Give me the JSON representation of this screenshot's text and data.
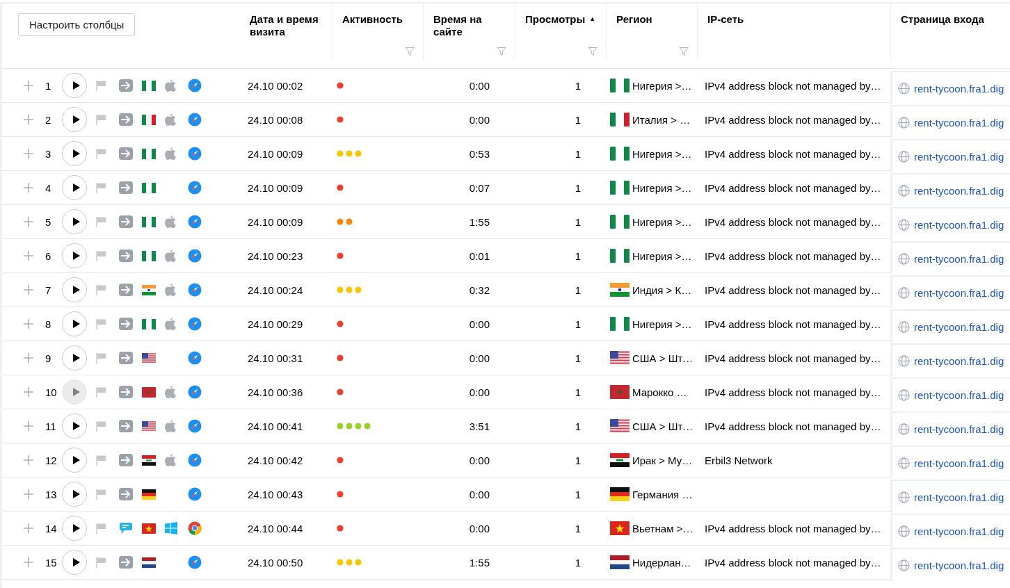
{
  "toolbar": {
    "configure_button": "Настроить столбцы"
  },
  "columns": [
    {
      "label": "Дата и время визита",
      "filter": false
    },
    {
      "label": "Активность",
      "filter": true
    },
    {
      "label": "Время на сайте",
      "filter": true
    },
    {
      "label": "Просмотры",
      "filter": true,
      "sort_mark": "▲"
    },
    {
      "label": "Регион",
      "filter": true
    },
    {
      "label": "IP-сеть",
      "filter": false
    },
    {
      "label": "Страница входа",
      "filter": false
    }
  ],
  "rows": [
    {
      "number": "1",
      "viewed": false,
      "source": {
        "kind": "direct"
      },
      "country": {
        "kind": "ng"
      },
      "os": {
        "kind": "apple"
      },
      "browser": {
        "kind": "safari"
      },
      "datetime": "24.10 00:02",
      "activity": {
        "kind": "low"
      },
      "duration": "0:00",
      "views": "1",
      "region": "Нигерия >…",
      "ip": "IPv4 address block not managed by…",
      "page": "rent-tycoon.fra1.dig"
    },
    {
      "number": "2",
      "viewed": false,
      "source": {
        "kind": "direct"
      },
      "country": {
        "kind": "it"
      },
      "os": {
        "kind": "apple"
      },
      "browser": {
        "kind": "safari"
      },
      "datetime": "24.10 00:08",
      "activity": {
        "kind": "low"
      },
      "duration": "0:00",
      "views": "1",
      "region": "Италия > …",
      "ip": "IPv4 address block not managed by…",
      "page": "rent-tycoon.fra1.dig"
    },
    {
      "number": "3",
      "viewed": false,
      "source": {
        "kind": "direct"
      },
      "country": {
        "kind": "ng"
      },
      "os": {
        "kind": "apple"
      },
      "browser": {
        "kind": "safari"
      },
      "datetime": "24.10 00:09",
      "activity": {
        "kind": "medium"
      },
      "duration": "0:53",
      "views": "1",
      "region": "Нигерия >…",
      "ip": "IPv4 address block not managed by…",
      "page": "rent-tycoon.fra1.dig"
    },
    {
      "number": "4",
      "viewed": false,
      "source": {
        "kind": "direct"
      },
      "country": {
        "kind": "ng"
      },
      "browser": {
        "kind": "safari"
      },
      "datetime": "24.10 00:09",
      "activity": {
        "kind": "low"
      },
      "duration": "0:07",
      "views": "1",
      "region": "Нигерия >…",
      "ip": "IPv4 address block not managed by…",
      "page": "rent-tycoon.fra1.dig"
    },
    {
      "number": "5",
      "viewed": false,
      "source": {
        "kind": "direct"
      },
      "country": {
        "kind": "ng"
      },
      "os": {
        "kind": "apple"
      },
      "browser": {
        "kind": "safari"
      },
      "datetime": "24.10 00:09",
      "activity": {
        "kind": "fair"
      },
      "duration": "1:55",
      "views": "1",
      "region": "Нигерия >…",
      "ip": "IPv4 address block not managed by…",
      "page": "rent-tycoon.fra1.dig"
    },
    {
      "number": "6",
      "viewed": false,
      "source": {
        "kind": "direct"
      },
      "country": {
        "kind": "ng"
      },
      "os": {
        "kind": "apple"
      },
      "browser": {
        "kind": "safari"
      },
      "datetime": "24.10 00:23",
      "activity": {
        "kind": "low"
      },
      "duration": "0:01",
      "views": "1",
      "region": "Нигерия >…",
      "ip": "IPv4 address block not managed by…",
      "page": "rent-tycoon.fra1.dig"
    },
    {
      "number": "7",
      "viewed": false,
      "source": {
        "kind": "direct"
      },
      "country": {
        "kind": "in"
      },
      "os": {
        "kind": "apple"
      },
      "browser": {
        "kind": "safari"
      },
      "datetime": "24.10 00:24",
      "activity": {
        "kind": "medium"
      },
      "duration": "0:32",
      "views": "1",
      "region": "Индия > К…",
      "ip": "IPv4 address block not managed by…",
      "page": "rent-tycoon.fra1.dig"
    },
    {
      "number": "8",
      "viewed": false,
      "source": {
        "kind": "direct"
      },
      "country": {
        "kind": "ng"
      },
      "os": {
        "kind": "apple"
      },
      "browser": {
        "kind": "safari"
      },
      "datetime": "24.10 00:29",
      "activity": {
        "kind": "low"
      },
      "duration": "0:00",
      "views": "1",
      "region": "Нигерия >…",
      "ip": "IPv4 address block not managed by…",
      "page": "rent-tycoon.fra1.dig"
    },
    {
      "number": "9",
      "viewed": false,
      "source": {
        "kind": "direct"
      },
      "country": {
        "kind": "us"
      },
      "browser": {
        "kind": "safari"
      },
      "datetime": "24.10 00:31",
      "activity": {
        "kind": "low"
      },
      "duration": "0:00",
      "views": "1",
      "region": "США > Шт…",
      "ip": "IPv4 address block not managed by…",
      "page": "rent-tycoon.fra1.dig"
    },
    {
      "number": "10",
      "viewed": true,
      "source": {
        "kind": "direct"
      },
      "country": {
        "kind": "ma"
      },
      "os": {
        "kind": "apple"
      },
      "browser": {
        "kind": "safari"
      },
      "datetime": "24.10 00:36",
      "activity": {
        "kind": "low"
      },
      "duration": "0:00",
      "views": "1",
      "region": "Марокко …",
      "ip": "IPv4 address block not managed by…",
      "page": "rent-tycoon.fra1.dig"
    },
    {
      "number": "11",
      "viewed": false,
      "source": {
        "kind": "direct"
      },
      "country": {
        "kind": "us"
      },
      "os": {
        "kind": "apple"
      },
      "browser": {
        "kind": "safari"
      },
      "datetime": "24.10 00:41",
      "activity": {
        "kind": "high"
      },
      "duration": "3:51",
      "views": "1",
      "region": "США > Шт…",
      "ip": "IPv4 address block not managed by…",
      "page": "rent-tycoon.fra1.dig"
    },
    {
      "number": "12",
      "viewed": false,
      "source": {
        "kind": "direct"
      },
      "country": {
        "kind": "iq"
      },
      "os": {
        "kind": "apple"
      },
      "browser": {
        "kind": "safari"
      },
      "datetime": "24.10 00:42",
      "activity": {
        "kind": "low"
      },
      "duration": "0:00",
      "views": "1",
      "region": "Ирак > Му…",
      "ip": "Erbil3 Network",
      "page": "rent-tycoon.fra1.dig"
    },
    {
      "number": "13",
      "viewed": false,
      "source": {
        "kind": "direct"
      },
      "country": {
        "kind": "de"
      },
      "browser": {
        "kind": "safari"
      },
      "datetime": "24.10 00:43",
      "activity": {
        "kind": "low"
      },
      "duration": "0:00",
      "views": "1",
      "region": "Германия …",
      "page": "rent-tycoon.fra1.dig"
    },
    {
      "number": "14",
      "viewed": false,
      "source": {
        "kind": "messenger"
      },
      "country": {
        "kind": "vn"
      },
      "os": {
        "kind": "windows"
      },
      "browser": {
        "kind": "chrome"
      },
      "datetime": "24.10 00:44",
      "activity": {
        "kind": "low"
      },
      "duration": "0:00",
      "views": "1",
      "region": "Вьетнам >…",
      "ip": "IPv4 address block not managed by…",
      "page": "rent-tycoon.fra1.dig"
    },
    {
      "number": "15",
      "viewed": false,
      "source": {
        "kind": "direct"
      },
      "country": {
        "kind": "nl"
      },
      "browser": {
        "kind": "safari"
      },
      "datetime": "24.10 00:50",
      "activity": {
        "kind": "medium"
      },
      "duration": "1:55",
      "views": "1",
      "region": "Нидерлан…",
      "ip": "IPv4 address block not managed by…",
      "page": "rent-tycoon.fra1.dig"
    }
  ]
}
